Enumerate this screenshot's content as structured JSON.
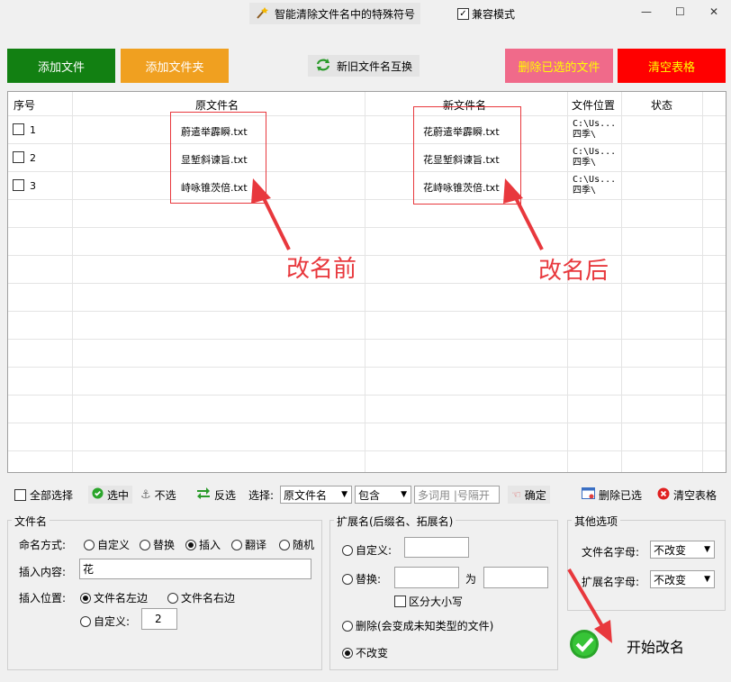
{
  "window": {
    "title": "智能清除文件名中的特殊符号",
    "compat_label": "兼容模式",
    "compat_checked": true
  },
  "toolbar": {
    "add_file": "添加文件",
    "add_folder": "添加文件夹",
    "swap": "新旧文件名互换",
    "delete_selected": "删除已选的文件",
    "clear_table": "清空表格"
  },
  "colors": {
    "add_file": "#128012",
    "add_folder": "#f0a020",
    "delete_selected": "#f06a8a",
    "clear_table": "#ff0000",
    "annotation": "#e8383d"
  },
  "table": {
    "headers": [
      "序号",
      "原文件名",
      "新文件名",
      "文件位置",
      "状态"
    ],
    "rows": [
      {
        "no": "1",
        "old": "蔚遣举霹瞬.txt",
        "new": "花蔚遣举霹瞬.txt",
        "path_line1": "C:\\Us...",
        "path_line2": "四季\\",
        "status": ""
      },
      {
        "no": "2",
        "old": "显堑斜谏旨.txt",
        "new": "花显堑斜谏旨.txt",
        "path_line1": "C:\\Us...",
        "path_line2": "四季\\",
        "status": ""
      },
      {
        "no": "3",
        "old": "峙咏锥茨倍.txt",
        "new": "花峙咏锥茨倍.txt",
        "path_line1": "C:\\Us...",
        "path_line2": "四季\\",
        "status": ""
      }
    ]
  },
  "annotations": {
    "before": "改名前",
    "after": "改名后"
  },
  "filter": {
    "select_all": "全部选择",
    "select": "选中",
    "deselect": "不选",
    "invert": "反选",
    "choose_label": "选择:",
    "field_value": "原文件名",
    "mode_value": "包含",
    "keyword_placeholder": "多词用 |号隔开",
    "confirm": "确定",
    "delete_selected": "删除已选",
    "clear_table": "清空表格"
  },
  "filename_group": {
    "title": "文件名",
    "naming_label": "命名方式:",
    "options": [
      "自定义",
      "替换",
      "插入",
      "翻译",
      "随机"
    ],
    "selected_option": "插入",
    "insert_content_label": "插入内容:",
    "insert_content_value": "花",
    "insert_pos_label": "插入位置:",
    "pos_left": "文件名左边",
    "pos_right": "文件名右边",
    "pos_custom": "自定义:",
    "pos_custom_value": "2"
  },
  "extension_group": {
    "title": "扩展名(后缀名、拓展名)",
    "custom": "自定义:",
    "replace": "替换:",
    "to": "为",
    "case_sensitive": "区分大小写",
    "delete": "删除(会变成未知类型的文件)",
    "unchanged": "不改变"
  },
  "other_group": {
    "title": "其他选项",
    "filename_case_label": "文件名字母:",
    "filename_case_value": "不改变",
    "ext_case_label": "扩展名字母:",
    "ext_case_value": "不改变"
  },
  "start_button": "开始改名"
}
